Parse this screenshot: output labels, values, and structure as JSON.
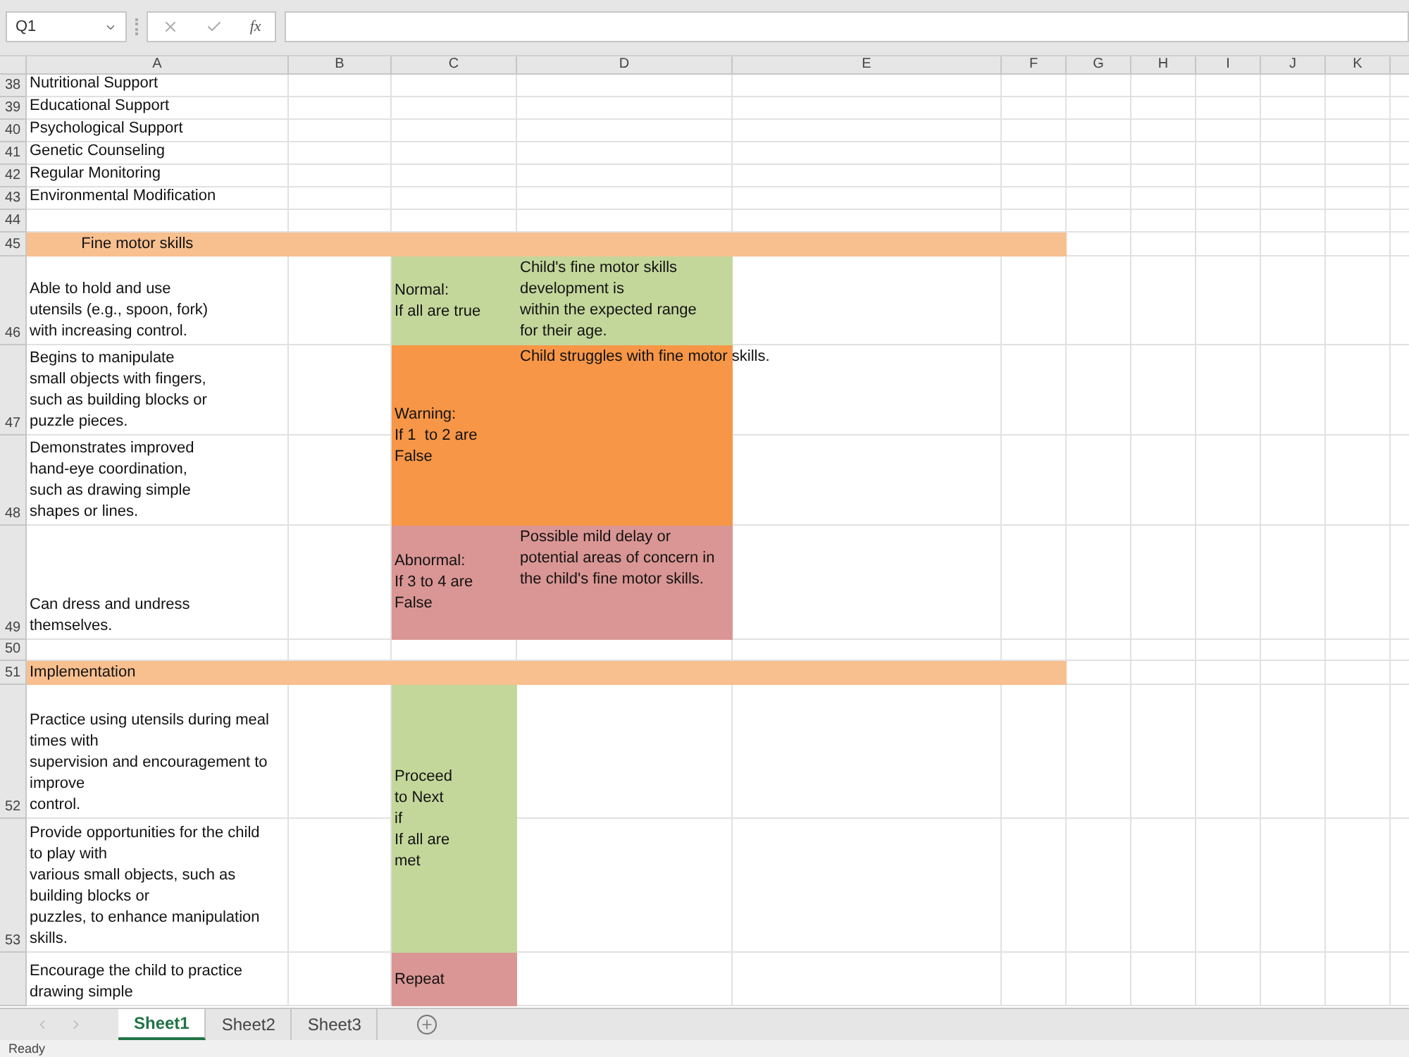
{
  "name_box": "Q1",
  "formula_bar": {
    "function_label": "fx"
  },
  "columns": [
    "A",
    "B",
    "C",
    "D",
    "E",
    "F",
    "G",
    "H",
    "I",
    "J",
    "K"
  ],
  "rows": [
    {
      "number": "38",
      "cells": [
        {
          "text": "Nutritional Support"
        }
      ]
    },
    {
      "number": "39",
      "cells": [
        {
          "text": "Educational Support"
        }
      ]
    },
    {
      "number": "40",
      "cells": [
        {
          "text": "Psychological Support"
        }
      ]
    },
    {
      "number": "41",
      "cells": [
        {
          "text": "Genetic Counseling"
        }
      ]
    },
    {
      "number": "42",
      "cells": [
        {
          "text": "Regular Monitoring"
        }
      ]
    },
    {
      "number": "43",
      "cells": [
        {
          "text": "Environmental Modification"
        }
      ]
    },
    {
      "number": "44",
      "cells": []
    },
    {
      "number": "45",
      "cells": [
        {
          "text": "            Fine motor skills",
          "color": "#f8bf8f"
        },
        {
          "merged": true
        },
        {
          "merged": true
        },
        {
          "merged": true
        },
        {
          "merged": true
        },
        {
          "merged": true
        }
      ]
    },
    {
      "number": "46",
      "cells": [
        {
          "text": "Able to hold and use\nutensils (e.g., spoon, fork)\nwith increasing control."
        },
        null,
        {
          "text": "Normal:\nIf all are true",
          "color": "#c4d79b"
        },
        {
          "text": "Child's fine motor skills\ndevelopment is\nwithin the expected range\nfor their age.",
          "color": "#c4d79b"
        }
      ]
    },
    {
      "number": "47",
      "cells": [
        {
          "text": "Begins to manipulate\nsmall objects with fingers,\nsuch as building blocks or\npuzzle pieces."
        },
        null,
        {
          "text": "Warning:\nIf 1  to 2 are\nFalse",
          "color": "#f79646"
        },
        {
          "text": "Child struggles with fine motor skills.",
          "color": "#f79646"
        }
      ]
    },
    {
      "number": "48",
      "cells": [
        {
          "text": "Demonstrates improved\nhand-eye coordination,\nsuch as drawing simple\nshapes or lines."
        },
        null,
        {
          "merged": true
        },
        {
          "merged": true
        }
      ]
    },
    {
      "number": "49",
      "cells": [
        {
          "text": "Can dress and undress\nthemselves."
        },
        null,
        {
          "text": "Abnormal:\nIf 3 to 4 are\nFalse",
          "color": "#da9694"
        },
        {
          "text": "Possible mild delay or\npotential areas of concern in\nthe child's fine motor skills.",
          "color": "#da9694"
        }
      ]
    },
    {
      "number": "50",
      "cells": []
    },
    {
      "number": "51",
      "cells": [
        {
          "text": "Implementation",
          "color": "#f8bf8f"
        },
        {
          "merged": true
        },
        {
          "merged": true
        },
        {
          "merged": true
        },
        {
          "merged": true
        },
        {
          "merged": true
        }
      ]
    },
    {
      "number": "52",
      "cells": [
        {
          "text": "Practice using utensils during meal\ntimes with\nsupervision and encouragement to\nimprove\ncontrol."
        },
        null,
        {
          "text": "Proceed\nto Next\nif\nIf all are\nmet",
          "color": "#c4d79b"
        }
      ]
    },
    {
      "number": "53",
      "cells": [
        {
          "text": "Provide opportunities for the child\nto play with\nvarious small objects, such as\nbuilding blocks or\npuzzles, to enhance manipulation\nskills."
        },
        null,
        {
          "merged": true
        }
      ]
    },
    {
      "cells": [
        {
          "text": "Encourage the child to practice\ndrawing simple"
        },
        null,
        {
          "text": "Repeat",
          "color": "#da9694"
        }
      ]
    }
  ],
  "sheets": [
    {
      "label": "Sheet1",
      "selected": true
    },
    {
      "label": "Sheet2",
      "selected": false
    },
    {
      "label": "Sheet3",
      "selected": false
    }
  ],
  "status_bar": "Ready"
}
